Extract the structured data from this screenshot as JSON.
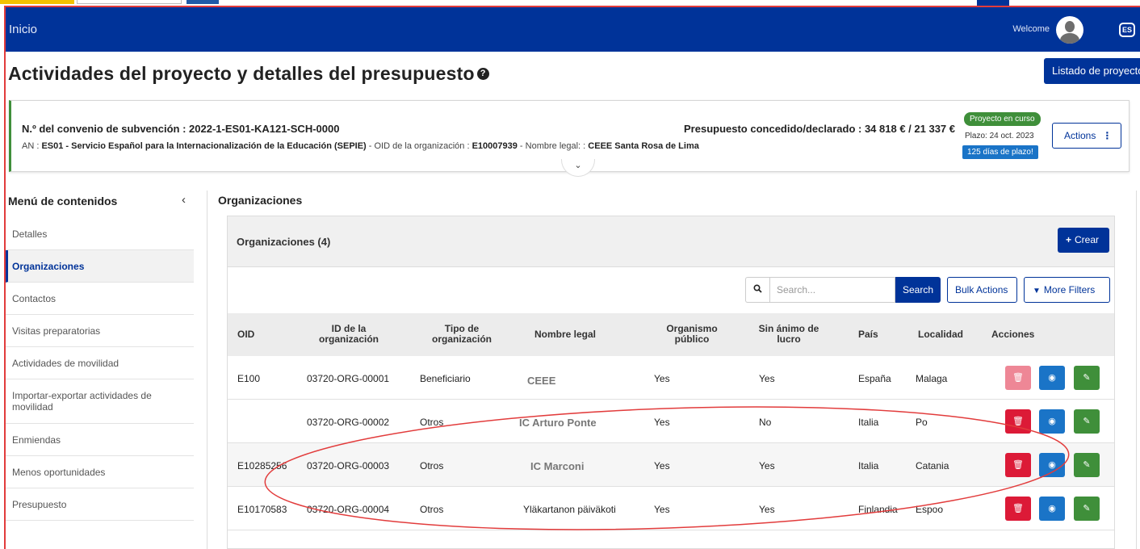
{
  "navbar": {
    "title": "Inicio",
    "welcome": "Welcome",
    "language": "ES"
  },
  "page": {
    "title": "Actividades del proyecto y detalles del presupuesto",
    "list_button": "Listado de proyectos"
  },
  "summary": {
    "grant_label": "N.º del convenio de subvención :",
    "grant_value": "2022-1-ES01-KA121-SCH-0000",
    "an_label": "AN :",
    "an_value": "ES01 - Servicio Español para la Internacionalización de la Educación (SEPIE)",
    "oid_label": "- OID de la organización :",
    "oid_value": "E10007939",
    "legal_label": "- Nombre legal: :",
    "legal_value": "CEEE Santa Rosa de Lima",
    "budget_label": "Presupuesto concedido/declarado :",
    "budget_value": "34 818 € / 21 337 €",
    "status_badge": "Proyecto en curso",
    "deadline": "Plazo: 24 oct. 2023",
    "days_badge": "125 días de plazo!",
    "actions_label": "Actions"
  },
  "sidebar": {
    "title": "Menú de contenidos",
    "items": [
      {
        "label": "Detalles",
        "active": false
      },
      {
        "label": "Organizaciones",
        "active": true
      },
      {
        "label": "Contactos",
        "active": false
      },
      {
        "label": "Visitas preparatorias",
        "active": false
      },
      {
        "label": "Actividades de movilidad",
        "active": false
      },
      {
        "label": "Importar-exportar actividades de movilidad",
        "active": false
      },
      {
        "label": "Enmiendas",
        "active": false
      },
      {
        "label": "Menos oportunidades",
        "active": false
      },
      {
        "label": "Presupuesto",
        "active": false
      }
    ]
  },
  "main": {
    "section_title": "Organizaciones",
    "panel_title": "Organizaciones (4)",
    "create_label": "Crear",
    "search_placeholder": "Search...",
    "search_label": "Search",
    "bulk_label": "Bulk Actions",
    "filters_label": "More Filters",
    "columns": [
      "OID",
      "ID de la organización",
      "Tipo de organización",
      "Nombre legal",
      "Organismo público",
      "Sin ánimo de lucro",
      "País",
      "Localidad",
      "Acciones"
    ],
    "rows": [
      {
        "oid": "E100",
        "org_id": "03720-ORG-00001",
        "type": "Beneficiario",
        "name": "CEEE",
        "public": "Yes",
        "nonprofit": "Yes",
        "country": "España",
        "city": "Malaga",
        "delete_disabled": true
      },
      {
        "oid": "",
        "org_id": "03720-ORG-00002",
        "type": "Otros",
        "name": "IC Arturo Ponte",
        "public": "Yes",
        "nonprofit": "No",
        "country": "Italia",
        "city": "Po",
        "delete_disabled": false
      },
      {
        "oid": "E10285256",
        "org_id": "03720-ORG-00003",
        "type": "Otros",
        "name": "IC Marconi",
        "public": "Yes",
        "nonprofit": "Yes",
        "country": "Italia",
        "city": "Catania",
        "delete_disabled": false
      },
      {
        "oid": "E10170583",
        "org_id": "03720-ORG-00004",
        "type": "Otros",
        "name": "Yläkartanon päiväkoti",
        "public": "Yes",
        "nonprofit": "Yes",
        "country": "Finlandia",
        "city": "Espoo",
        "delete_disabled": false
      }
    ]
  },
  "colors": {
    "brand": "#003399",
    "success": "#3f8f3a",
    "danger": "#dc1a37",
    "info": "#1a74c7",
    "annotation": "#e23c3c"
  },
  "icons": [
    "help-icon",
    "avatar-icon",
    "language-icon",
    "kebab-icon",
    "chevron-down-icon",
    "chevron-left-icon",
    "plus-icon",
    "search-icon",
    "filter-icon",
    "trash-icon",
    "eye-icon",
    "edit-icon"
  ]
}
